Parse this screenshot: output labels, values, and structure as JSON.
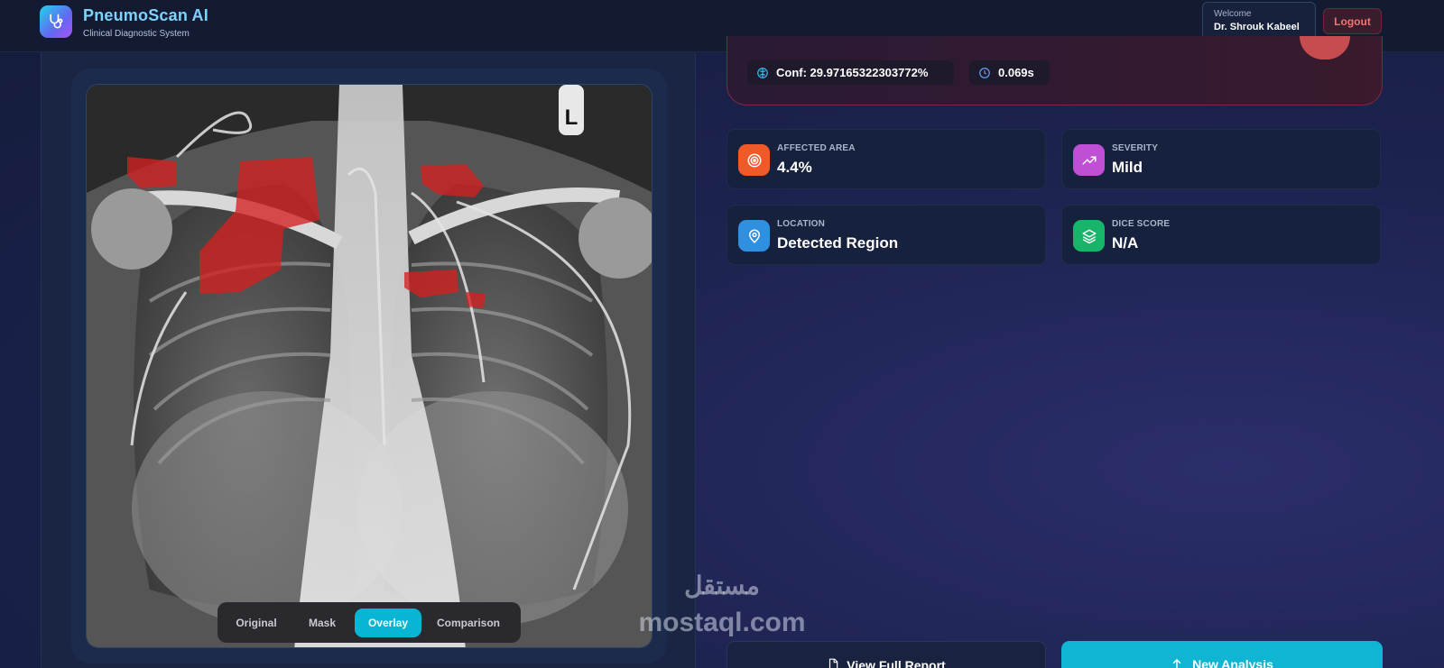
{
  "app": {
    "title": "PneumoScan AI",
    "subtitle": "Clinical Diagnostic System"
  },
  "user": {
    "welcome_label": "Welcome",
    "name": "Dr. Shrouk Kabeel",
    "logout_label": "Logout"
  },
  "viewer": {
    "marker_label": "L",
    "tabs": [
      {
        "label": "Original",
        "active": false
      },
      {
        "label": "Mask",
        "active": false
      },
      {
        "label": "Overlay",
        "active": true
      },
      {
        "label": "Comparison",
        "active": false
      }
    ]
  },
  "result": {
    "confidence": "Conf: 29.97165322303772%",
    "time": "0.069s"
  },
  "stats": [
    {
      "label": "AFFECTED AREA",
      "value": "4.4%",
      "icon": "target-icon",
      "color": "#f05a28"
    },
    {
      "label": "SEVERITY",
      "value": "Mild",
      "icon": "trend-up-icon",
      "color": "#c04fd6"
    },
    {
      "label": "LOCATION",
      "value": "Detected Region",
      "icon": "map-pin-icon",
      "color": "#2f8fe0"
    },
    {
      "label": "DICE SCORE",
      "value": "N/A",
      "icon": "layers-icon",
      "color": "#16b56a"
    }
  ],
  "actions": {
    "report_label": "View Full Report",
    "new_label": "New Analysis"
  },
  "watermark": {
    "arabic": "مستقل",
    "latin": "mostaql.com"
  },
  "colors": {
    "accent": "#06b6d4",
    "danger": "#f87171",
    "overlay_red": "#d42020"
  }
}
